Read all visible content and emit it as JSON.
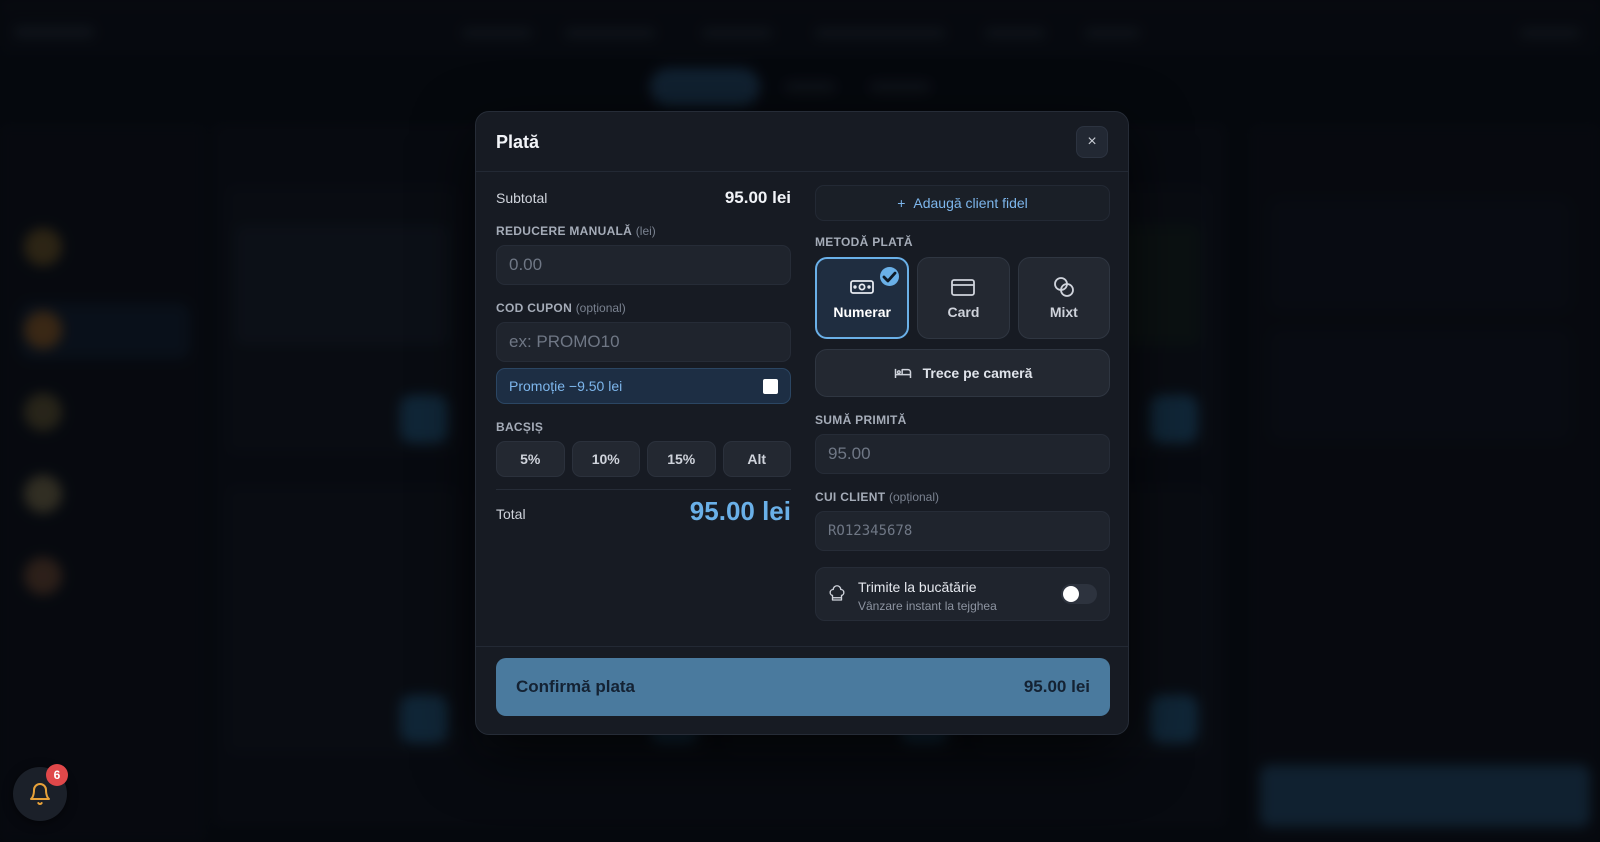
{
  "modal": {
    "title": "Plată",
    "close_icon": "×"
  },
  "summary": {
    "subtotal_label": "Subtotal",
    "subtotal_value": "95.00 lei",
    "manual_discount_label": "REDUCERE MANUALĂ",
    "manual_discount_unit": "(lei)",
    "manual_discount_placeholder": "0.00",
    "coupon_label": "COD CUPON",
    "coupon_optional": "(opțional)",
    "coupon_placeholder": "ex: PROMO10",
    "promotion_text": "Promoție −9.50 lei",
    "tip_label": "BACȘIȘ",
    "tips": [
      "5%",
      "10%",
      "15%",
      "Alt"
    ],
    "total_label": "Total",
    "total_value": "95.00 lei"
  },
  "payment": {
    "add_client_label": "Adaugă client fidel",
    "method_label": "METODĂ PLATĂ",
    "methods": [
      {
        "label": "Numerar",
        "icon": "cash-icon",
        "selected": true
      },
      {
        "label": "Card",
        "icon": "card-icon",
        "selected": false
      },
      {
        "label": "Mixt",
        "icon": "coins-icon",
        "selected": false
      }
    ],
    "room_label": "Trece pe cameră",
    "received_label": "SUMĂ PRIMITĂ",
    "received_placeholder": "95.00",
    "cui_label": "CUI CLIENT",
    "cui_optional": "(opțional)",
    "cui_placeholder": "RO12345678",
    "kitchen_title": "Trimite la bucătărie",
    "kitchen_subtitle": "Vânzare instant la tejghea",
    "kitchen_enabled": false
  },
  "confirm": {
    "label": "Confirmă plata",
    "amount": "95.00 lei"
  },
  "notifications": {
    "count": "6"
  },
  "colors": {
    "accent": "#6ab0e8",
    "confirm_bg": "#4a7a9e",
    "badge": "#e0484a"
  }
}
